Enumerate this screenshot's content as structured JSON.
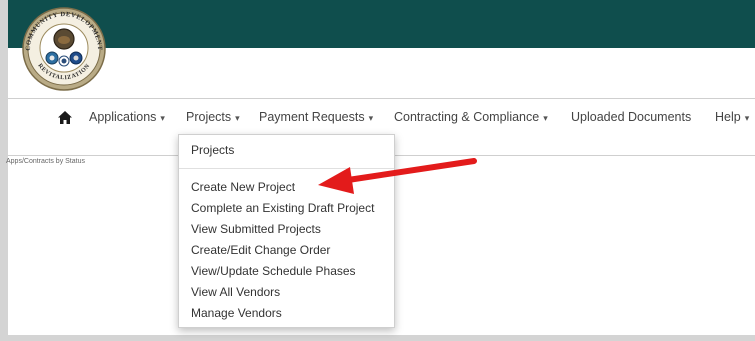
{
  "colors": {
    "header": "#0f4e4d",
    "arrow": "#e31b1b"
  },
  "logo": {
    "ring_text_top": "COMMUNITY DEVELOPMENT",
    "ring_text_bottom": "REVITALIZATION"
  },
  "nav": {
    "home_icon": "home-icon",
    "items": [
      {
        "label": "Applications",
        "has_caret": true
      },
      {
        "label": "Projects",
        "has_caret": true
      },
      {
        "label": "Payment Requests",
        "has_caret": true
      },
      {
        "label": "Contracting & Compliance",
        "has_caret": true
      },
      {
        "label": "Uploaded Documents",
        "has_caret": false
      },
      {
        "label": "Help",
        "has_caret": true
      }
    ]
  },
  "breadcrumb": "Apps/Contracts by Status",
  "dropdown": {
    "header": "Projects",
    "items": [
      "Create New Project",
      "Complete an Existing Draft Project",
      "View Submitted Projects",
      "Create/Edit Change Order",
      "View/Update Schedule Phases",
      "View All Vendors",
      "Manage Vendors"
    ]
  }
}
